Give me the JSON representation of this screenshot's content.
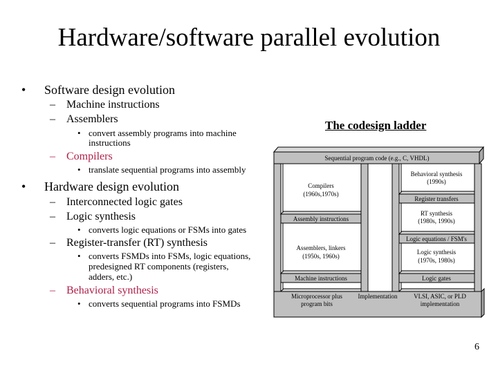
{
  "slide": {
    "title": "Hardware/software parallel evolution",
    "page_number": "6",
    "accent_color": "#b0204a"
  },
  "outline": {
    "software": {
      "label": "Software design evolution",
      "items": [
        {
          "label": "Machine instructions",
          "highlight": false
        },
        {
          "label": "Assemblers",
          "highlight": false,
          "sub": [
            "convert assembly programs into machine",
            "instructions"
          ]
        },
        {
          "label": "Compilers",
          "highlight": true,
          "sub": [
            "translate sequential programs into assembly"
          ]
        }
      ]
    },
    "hardware": {
      "label": "Hardware design evolution",
      "items": [
        {
          "label": "Interconnected logic gates",
          "highlight": false
        },
        {
          "label": "Logic synthesis",
          "highlight": false,
          "sub": [
            "converts logic equations or FSMs into gates"
          ]
        },
        {
          "label": "Register-transfer (RT) synthesis",
          "highlight": false,
          "sub": [
            "converts FSMDs into FSMs, logic equations,",
            "predesigned RT components (registers,",
            "adders, etc.)"
          ]
        },
        {
          "label": "Behavioral synthesis",
          "highlight": true,
          "sub": [
            "converts sequential programs into FSMDs"
          ]
        }
      ]
    }
  },
  "ladder": {
    "title": "The codesign ladder",
    "top_bar": "Sequential program code (e.g., C, VHDL)",
    "software_side": {
      "compilers": [
        "Compilers",
        "(1960s,1970s)"
      ],
      "assembly_instructions": "Assembly instructions",
      "assemblers": [
        "Assemblers, linkers",
        "(1950s, 1960s)"
      ],
      "machine_instructions": "Machine instructions"
    },
    "hardware_side": {
      "behavioral": [
        "Behavioral synthesis",
        "(1990s)"
      ],
      "register_transfers": "Register transfers",
      "rt_synthesis": [
        "RT synthesis",
        "(1980s, 1990s)"
      ],
      "logic_equations": "Logic equations / FSM's",
      "logic_synthesis": [
        "Logic synthesis",
        "(1970s, 1980s)"
      ],
      "logic_gates": "Logic gates"
    },
    "base": {
      "left": [
        "Microprocessor plus",
        "program bits"
      ],
      "center": "Implementation",
      "right": [
        "VLSI, ASIC, or PLD",
        "implementation"
      ]
    }
  },
  "glyphs": {
    "bullet": "•",
    "dash": "–"
  }
}
